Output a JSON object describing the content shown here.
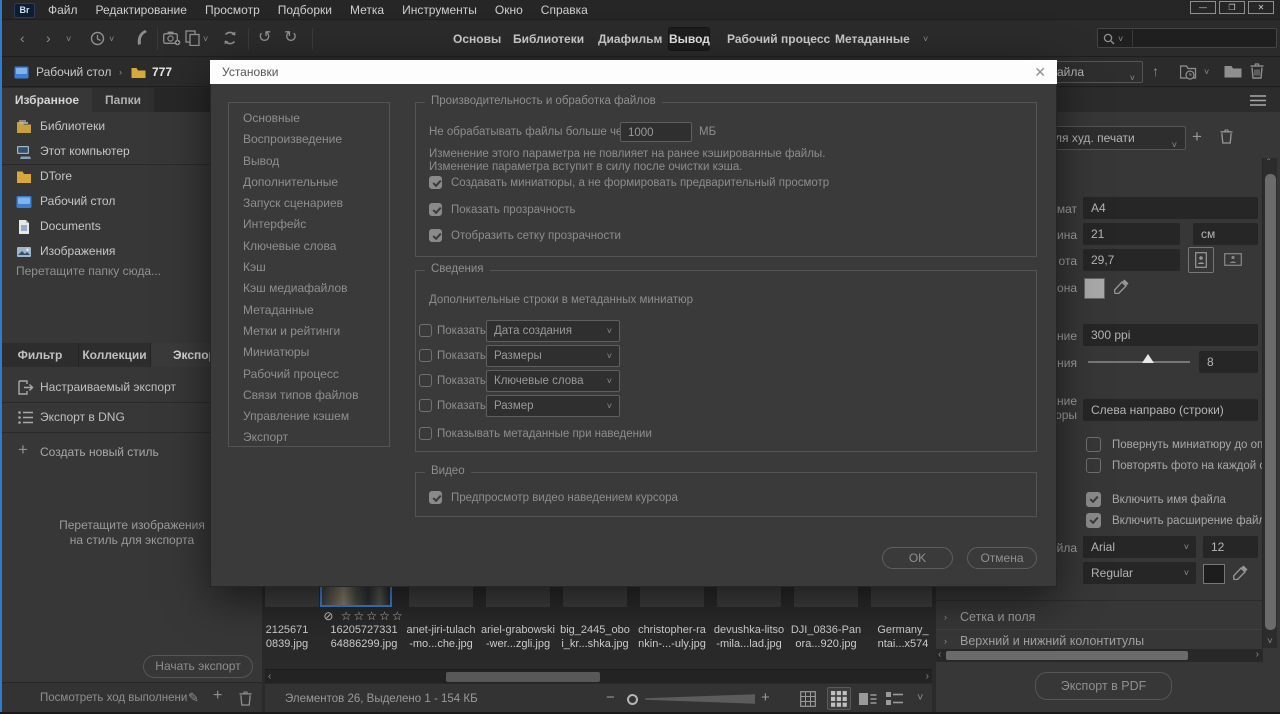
{
  "menubar": {
    "app_badge": "Br",
    "items": [
      "Файл",
      "Редактирование",
      "Просмотр",
      "Подборки",
      "Метка",
      "Инструменты",
      "Окно",
      "Справка"
    ]
  },
  "workspace_tabs": {
    "items": [
      "Основы",
      "Библиотеки",
      "Диафильм",
      "Вывод",
      "Рабочий процесс",
      "Метаданные"
    ],
    "active": "Вывод"
  },
  "pathbar": {
    "crumb1": "Рабочий стол",
    "crumb2": "777",
    "sort_dropdown_visible": "айла"
  },
  "left": {
    "tabs": {
      "favorites": "Избранное",
      "folders": "Папки"
    },
    "favorites": [
      {
        "label": "Библиотеки"
      },
      {
        "label": "Этот компьютер"
      },
      {
        "label": "DTore"
      },
      {
        "label": "Рабочий стол"
      },
      {
        "label": "Documents"
      },
      {
        "label": "Изображения"
      }
    ],
    "drop_hint": "Перетащите папку сюда...",
    "export_tabs": {
      "filter": "Фильтр",
      "collections": "Коллекции",
      "export": "Экспорт"
    },
    "export_items": [
      {
        "label": "Настраиваемый экспорт"
      },
      {
        "label": "Экспорт в DNG"
      },
      {
        "label": "Создать новый стиль"
      }
    ],
    "drop_hint2_line1": "Перетащите изображения",
    "drop_hint2_line2": "на стиль для экспорта",
    "start_export": "Начать экспорт",
    "progress_label": "Посмотреть ход выполнени"
  },
  "dialog": {
    "title": "Установки",
    "nav": [
      "Основные",
      "Воспроизведение",
      "Вывод",
      "Дополнительные",
      "Запуск сценариев",
      "Интерфейс",
      "Ключевые слова",
      "Кэш",
      "Кэш медиафайлов",
      "Метаданные",
      "Метки и рейтинги",
      "Миниатюры",
      "Рабочий процесс",
      "Связи типов файлов",
      "Управление кэшем",
      "Экспорт"
    ],
    "perf": {
      "legend": "Производительность и обработка файлов",
      "limit_label": "Не обрабатывать файлы больше чем",
      "limit_value": "1000",
      "limit_unit": "МБ",
      "note1": "Изменение этого параметра не повлияет на ранее кэшированные файлы.",
      "note2": "Изменение параметра вступит в силу после очистки кэша.",
      "cb1": "Создавать миниатюры, а не формировать предварительный просмотр",
      "cb2": "Показать прозрачность",
      "cb3": "Отобразить сетку прозрачности"
    },
    "details": {
      "legend": "Сведения",
      "subtitle": "Дополнительные строки в метаданных миниатюр",
      "show_label": "Показать",
      "rows": [
        {
          "value": "Дата создания"
        },
        {
          "value": "Размеры"
        },
        {
          "value": "Ключевые слова"
        },
        {
          "value": "Размер"
        }
      ],
      "hover_cb": "Показывать метаданные при наведении"
    },
    "video": {
      "legend": "Видео",
      "cb": "Предпросмотр видео наведением курсора"
    },
    "ok": "OK",
    "cancel": "Отмена"
  },
  "right": {
    "preset_dropdown_visible": "ля худ. печати",
    "fields": {
      "format_label": "мат",
      "format_value": "A4",
      "width_label": "ина",
      "width_value": "21",
      "unit_value": "см",
      "height_label": "ота",
      "height_value": "29,7",
      "bg_label": "она",
      "resolution_label": "ние",
      "resolution_value": "300 ppi",
      "quality_label": "ния",
      "quality_value": "8",
      "layout_label1": "ние",
      "layout_label2": "юры",
      "layout_value": "Слева направо (строки)",
      "cb_rotate": "Повернуть миниатюру до оптимальн",
      "cb_repeat": "Повторять фото на каждой страниц",
      "cb_filename": "Включить имя файла",
      "cb_extension": "Включить расширение файлов",
      "font_label": "йла",
      "font_value": "Arial",
      "font_size": "12",
      "font_style": "Regular"
    },
    "sections": {
      "grid": "Сетка и поля",
      "headers": "Верхний и нижний колонтитулы"
    },
    "export_pdf": "Экспорт в PDF"
  },
  "content": {
    "thumbs": [
      {
        "l1": "2125671",
        "l2": "0839.jpg"
      },
      {
        "l1": "16205727331",
        "l2": "64886299.jpg"
      },
      {
        "l1": "anet-jiri-tulach",
        "l2": "-mo...che.jpg"
      },
      {
        "l1": "ariel-grabowski",
        "l2": "-wer...zgli.jpg"
      },
      {
        "l1": "big_2445_obo",
        "l2": "i_kr...shka.jpg"
      },
      {
        "l1": "christopher-ra",
        "l2": "nkin-...-uly.jpg"
      },
      {
        "l1": "devushka-litso",
        "l2": "-mila...lad.jpg"
      },
      {
        "l1": "DJI_0836-Pan",
        "l2": "ora...920.jpg"
      },
      {
        "l1": "Germany_",
        "l2": "ntai...x574"
      }
    ],
    "status": "Элементов 26, Выделено 1 - 154 КБ"
  }
}
